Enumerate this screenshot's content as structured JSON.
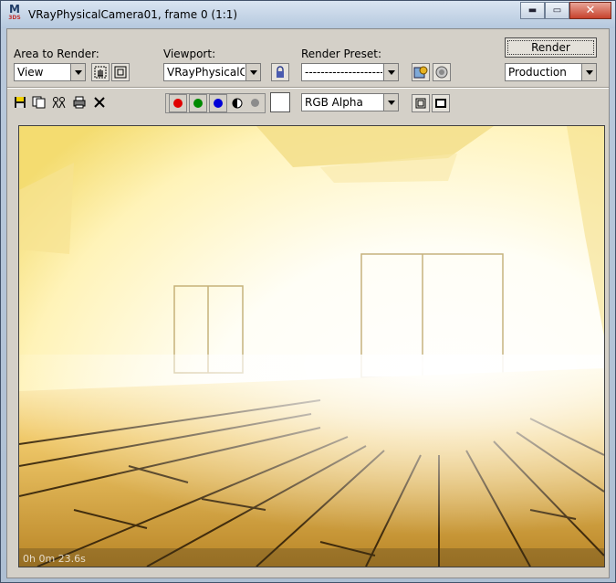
{
  "window": {
    "title": "VRayPhysicalCamera01, frame 0 (1:1)",
    "app_icon_top": "M",
    "app_icon_bottom": "3DS",
    "minimize_glyph": "▬",
    "maximize_glyph": "▭",
    "close_glyph": "✕"
  },
  "toolbar": {
    "area_label": "Area to Render:",
    "area_value": "View",
    "viewport_label": "Viewport:",
    "viewport_value": "VRayPhysicalCam",
    "preset_label": "Render Preset:",
    "preset_value": "-------------------------------",
    "render_label": "Render",
    "production_value": "Production",
    "channel_value": "RGB Alpha"
  },
  "colors": {
    "red_channel": "#e00000",
    "green_channel": "#008a00",
    "blue_channel": "#0000d8"
  },
  "render": {
    "time": "0h 0m 23.6s"
  }
}
